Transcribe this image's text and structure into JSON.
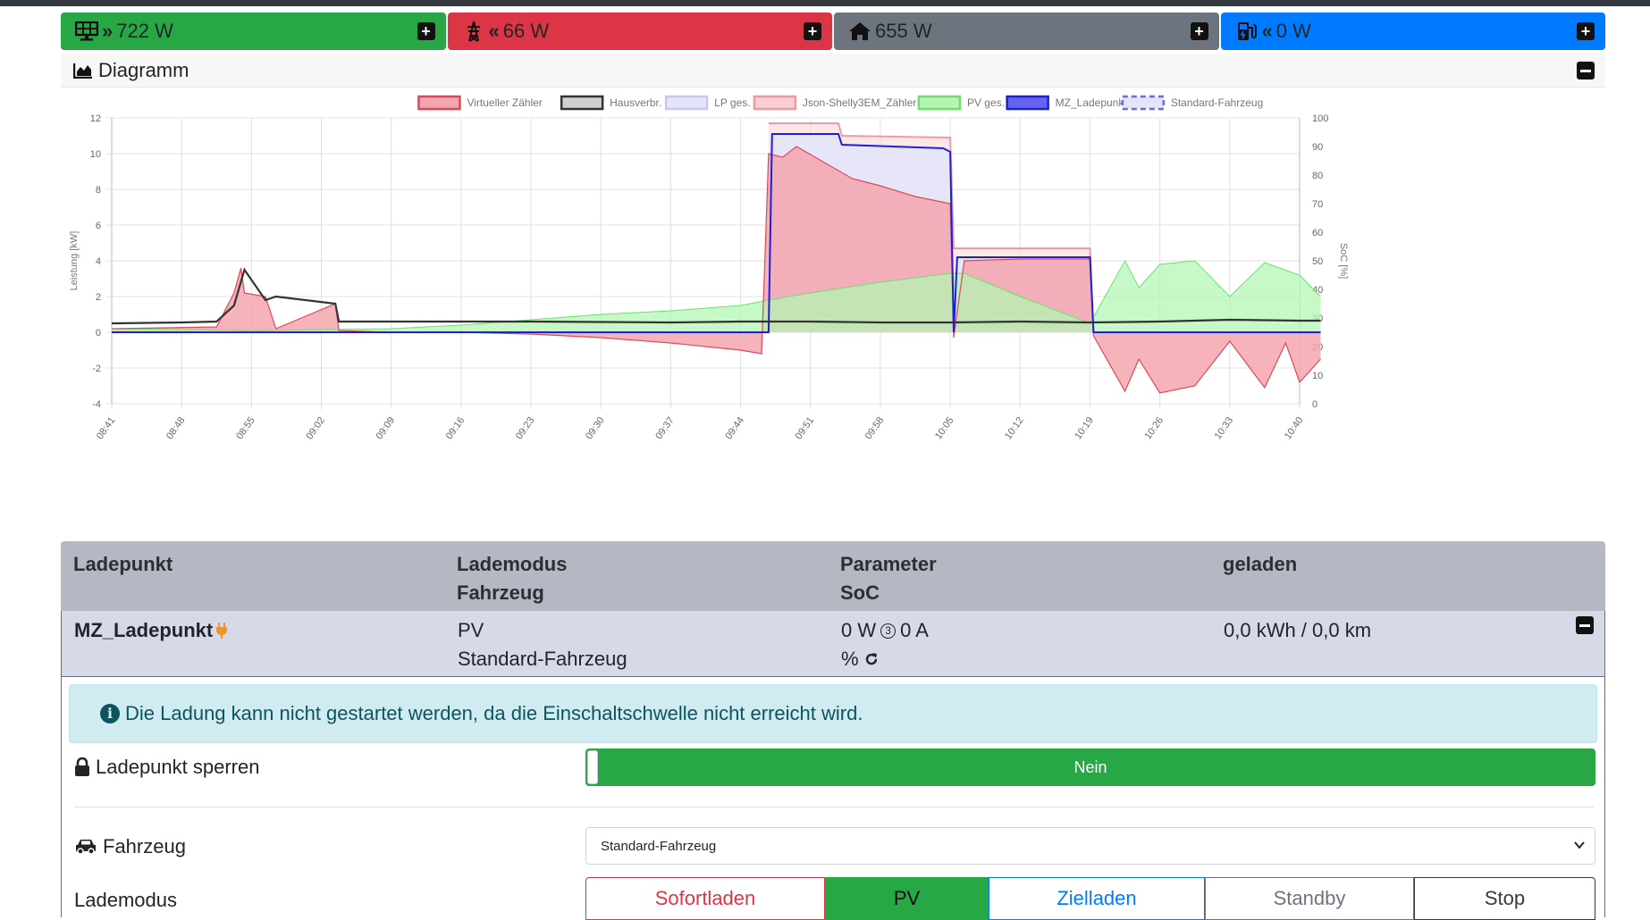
{
  "summary": [
    {
      "name": "pv",
      "arrows": "»",
      "value": "722 W",
      "color": "#28a745",
      "icon": "solar-panel-icon"
    },
    {
      "name": "grid",
      "arrows": "«",
      "value": "66 W",
      "color": "#dc3545",
      "icon": "power-tower-icon"
    },
    {
      "name": "house",
      "arrows": "",
      "value": "655 W",
      "color": "#6c757d",
      "icon": "home-icon"
    },
    {
      "name": "charge",
      "arrows": "«",
      "value": "0 W",
      "color": "#007bff",
      "icon": "charging-station-icon"
    }
  ],
  "diagram": {
    "title": "Diagramm"
  },
  "chart_data": {
    "type": "area",
    "legend_position": "top",
    "ylabel_left": "Leistung [kW]",
    "ylabel_right": "SoC [%]",
    "ylim": [
      -4,
      12
    ],
    "ylim_right": [
      0,
      100
    ],
    "yticks": [
      -4,
      -2,
      0,
      2,
      4,
      6,
      8,
      10,
      12
    ],
    "yticks_right": [
      0,
      10,
      20,
      30,
      40,
      50,
      60,
      70,
      80,
      90,
      100
    ],
    "x_categories": [
      "08:41",
      "08:48",
      "08:55",
      "09:02",
      "09:09",
      "09:16",
      "09:23",
      "09:30",
      "09:37",
      "09:44",
      "09:51",
      "09:58",
      "10:05",
      "10:12",
      "10:19",
      "10:26",
      "10:33",
      "10:40"
    ],
    "legend": [
      {
        "name": "Virtueller Zähler",
        "fill": "#f4a6ae",
        "stroke": "#e0485a",
        "dashed": false
      },
      {
        "name": "Hausverbr.",
        "fill": "#d0d0d0",
        "stroke": "#333333",
        "dashed": false
      },
      {
        "name": "LP ges.",
        "fill": "#e4e4fa",
        "stroke": "#c8c8f0",
        "dashed": false
      },
      {
        "name": "Json-Shelly3EM_Zähler",
        "fill": "#fbd0d4",
        "stroke": "#f29aa3",
        "dashed": false
      },
      {
        "name": "PV ges.",
        "fill": "#b4f5b4",
        "stroke": "#6ee06e",
        "dashed": false
      },
      {
        "name": "MZ_Ladepunkt",
        "fill": "#6464f0",
        "stroke": "#1e1ee0",
        "dashed": false
      },
      {
        "name": "Standard-Fahrzeug",
        "fill": "#e4e4fa",
        "stroke": "#6a6ae6",
        "dashed": true
      }
    ],
    "series": [
      {
        "name": "Virtueller Zähler",
        "x": [
          0,
          1.5,
          1.75,
          1.85,
          1.9,
          2.2,
          2.35,
          3.2,
          3.25,
          4,
          5,
          6,
          7,
          8,
          9,
          9.3,
          9.4,
          9.6,
          9.8,
          10.2,
          10.6,
          11,
          11.5,
          12,
          12.05,
          12.2,
          13,
          14,
          14.05,
          14.5,
          14.7,
          15,
          15.5,
          16,
          16.5,
          16.8,
          17,
          17.3
        ],
        "values": [
          0.2,
          0.3,
          2.2,
          3.6,
          2.2,
          2,
          0.2,
          1.6,
          0.1,
          0,
          0,
          -0.1,
          -0.3,
          -0.6,
          -1.0,
          -1.2,
          10,
          9.8,
          10.4,
          9.5,
          8.6,
          8.2,
          7.6,
          7.2,
          -0.3,
          4.0,
          4.1,
          4.1,
          -0.2,
          -3.3,
          -1.5,
          -3.4,
          -3.0,
          -0.5,
          -3.1,
          -0.6,
          -2.8,
          -1.5
        ]
      },
      {
        "name": "Hausverbr.",
        "x": [
          0,
          1,
          1.5,
          1.75,
          1.9,
          2.2,
          2.35,
          3.2,
          3.25,
          4,
          6,
          8,
          9,
          10,
          11,
          12,
          13,
          14,
          15,
          16,
          17,
          17.3
        ],
        "values": [
          0.5,
          0.55,
          0.6,
          1.5,
          3.5,
          1.8,
          2.0,
          1.6,
          0.6,
          0.6,
          0.6,
          0.55,
          0.6,
          0.6,
          0.55,
          0.55,
          0.6,
          0.55,
          0.6,
          0.7,
          0.65,
          0.65
        ]
      },
      {
        "name": "Json-Shelly3EM_Zähler",
        "x": [
          9.4,
          10.4,
          10.45,
          12,
          12.05,
          13,
          14,
          14.05
        ],
        "values": [
          11.7,
          11.7,
          11.0,
          10.9,
          4.7,
          4.7,
          4.7,
          0
        ]
      },
      {
        "name": "PV ges.",
        "x": [
          0,
          2,
          4,
          5,
          6,
          7,
          8,
          9,
          9.4,
          10,
          11,
          12,
          12.2,
          13,
          14,
          14.5,
          14.7,
          15,
          15.5,
          16,
          16.5,
          17,
          17.3
        ],
        "values": [
          0.2,
          0.1,
          0.2,
          0.4,
          0.7,
          1.0,
          1.2,
          1.5,
          1.8,
          2.2,
          2.8,
          3.3,
          3.3,
          2.0,
          0.5,
          4.0,
          2.5,
          3.8,
          4.0,
          2.0,
          3.9,
          3.2,
          2.0
        ]
      },
      {
        "name": "MZ_Ladepunkt",
        "x": [
          0,
          9.4,
          9.45,
          10.4,
          10.45,
          11.9,
          12,
          12.05,
          12.1,
          14,
          14.05,
          17.3
        ],
        "values": [
          0,
          0,
          11.1,
          11.1,
          10.5,
          10.3,
          10.1,
          0,
          4.2,
          4.2,
          0,
          0
        ]
      }
    ]
  },
  "loadpoint_table": {
    "headers": [
      {
        "line1": "Ladepunkt",
        "line2": ""
      },
      {
        "line1": "Lademodus",
        "line2": "Fahrzeug"
      },
      {
        "line1": "Parameter",
        "line2": "SoC"
      },
      {
        "line1": "geladen",
        "line2": ""
      }
    ],
    "row": {
      "name": "MZ_Ladepunkt",
      "mode": "PV",
      "vehicle": "Standard-Fahrzeug",
      "power": "0 W",
      "phases": "3",
      "current": "0 A",
      "soc": "%",
      "charged": "0,0 kWh / 0,0 km"
    }
  },
  "alert": {
    "text": "Die Ladung kann nicht gestartet werden, da die Einschaltschwelle nicht erreicht wird."
  },
  "lock": {
    "label": "Ladepunkt sperren",
    "value": "Nein"
  },
  "vehicle_select": {
    "label": "Fahrzeug",
    "value": "Standard-Fahrzeug"
  },
  "mode_select": {
    "label": "Lademodus",
    "options": [
      {
        "label": "Sofortladen",
        "color": "#dc3545",
        "active": false
      },
      {
        "label": "PV",
        "color": "#28a745",
        "active": true
      },
      {
        "label": "Zielladen",
        "color": "#007bff",
        "active": false
      },
      {
        "label": "Standby",
        "color": "#6c757d",
        "active": false
      },
      {
        "label": "Stop",
        "color": "#343a40",
        "active": false
      }
    ]
  }
}
